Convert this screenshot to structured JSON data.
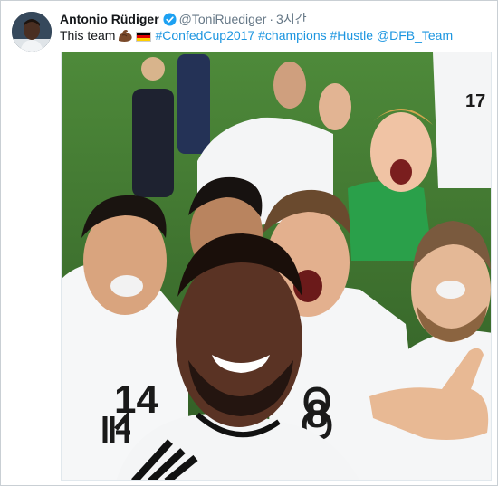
{
  "tweet": {
    "author_name": "Antonio Rüdiger",
    "handle": "@ToniRuediger",
    "separator": "·",
    "timestamp": "3시간",
    "text_prefix": "This team",
    "hashtags": [
      "#ConfedCup2017",
      "#champions",
      "#Hustle"
    ],
    "mention": "@DFB_Team",
    "emojis": [
      "muscle-emoji",
      "germany-flag-emoji"
    ]
  },
  "media": {
    "jersey_numbers": [
      "14",
      "8",
      "17"
    ]
  },
  "colors": {
    "verified_blue": "#1da1f2",
    "link_blue": "#1b95e0",
    "secondary_text": "#657786",
    "primary_text": "#14171a",
    "pitch_green": "#3c6d2e",
    "flag": [
      "#000000",
      "#dd0000",
      "#ffce00"
    ]
  }
}
